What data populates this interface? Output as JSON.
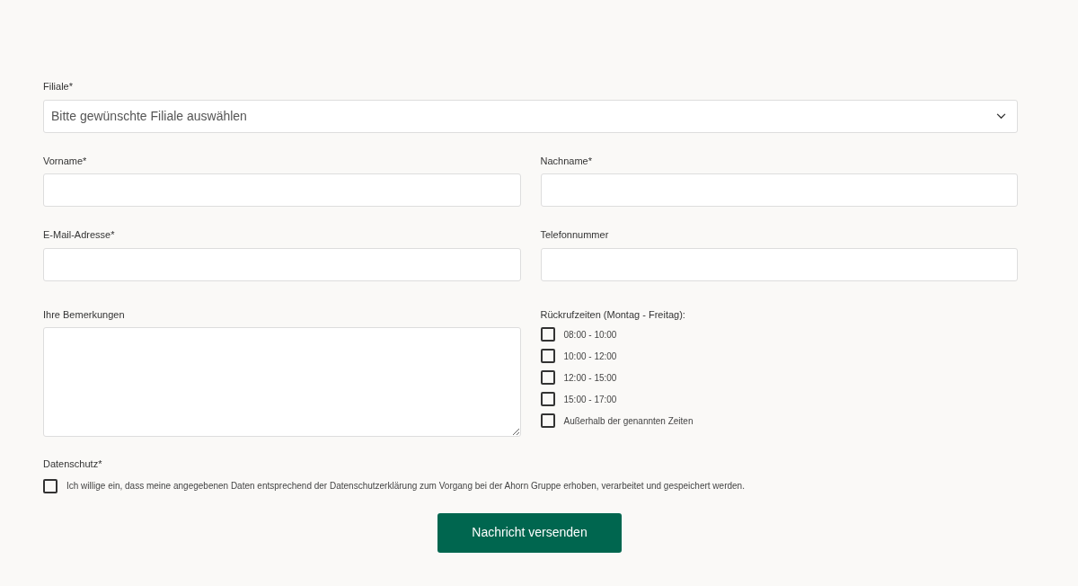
{
  "branch": {
    "label": "Filiale*",
    "value": "Bitte gewünschte Filiale auswählen"
  },
  "fields": [
    {
      "label": "Vorname*"
    },
    {
      "label": "Nachname*"
    },
    {
      "label": "E-Mail-Adresse*"
    },
    {
      "label": "Telefonnummer"
    }
  ],
  "remarks": {
    "label": "Ihre Bemerkungen"
  },
  "callback": {
    "label": "Rückrufzeiten (Montag - Freitag):",
    "options": [
      {
        "label": "08:00 - 10:00",
        "checked": false
      },
      {
        "label": "10:00 - 12:00",
        "checked": false
      },
      {
        "label": "12:00 - 15:00",
        "checked": false
      },
      {
        "label": "15:00 - 17:00",
        "checked": false
      },
      {
        "label": "Außerhalb der genannten Zeiten",
        "checked": false
      }
    ]
  },
  "privacy": {
    "label": "Datenschutz*",
    "text": "Ich willige ein, dass meine angegebenen Daten entsprechend der Datenschutzerklärung zum Vorgang bei der Ahorn Gruppe erhoben, verarbeitet und gespeichert werden.",
    "checked": false
  },
  "submit": "Nachricht versenden"
}
